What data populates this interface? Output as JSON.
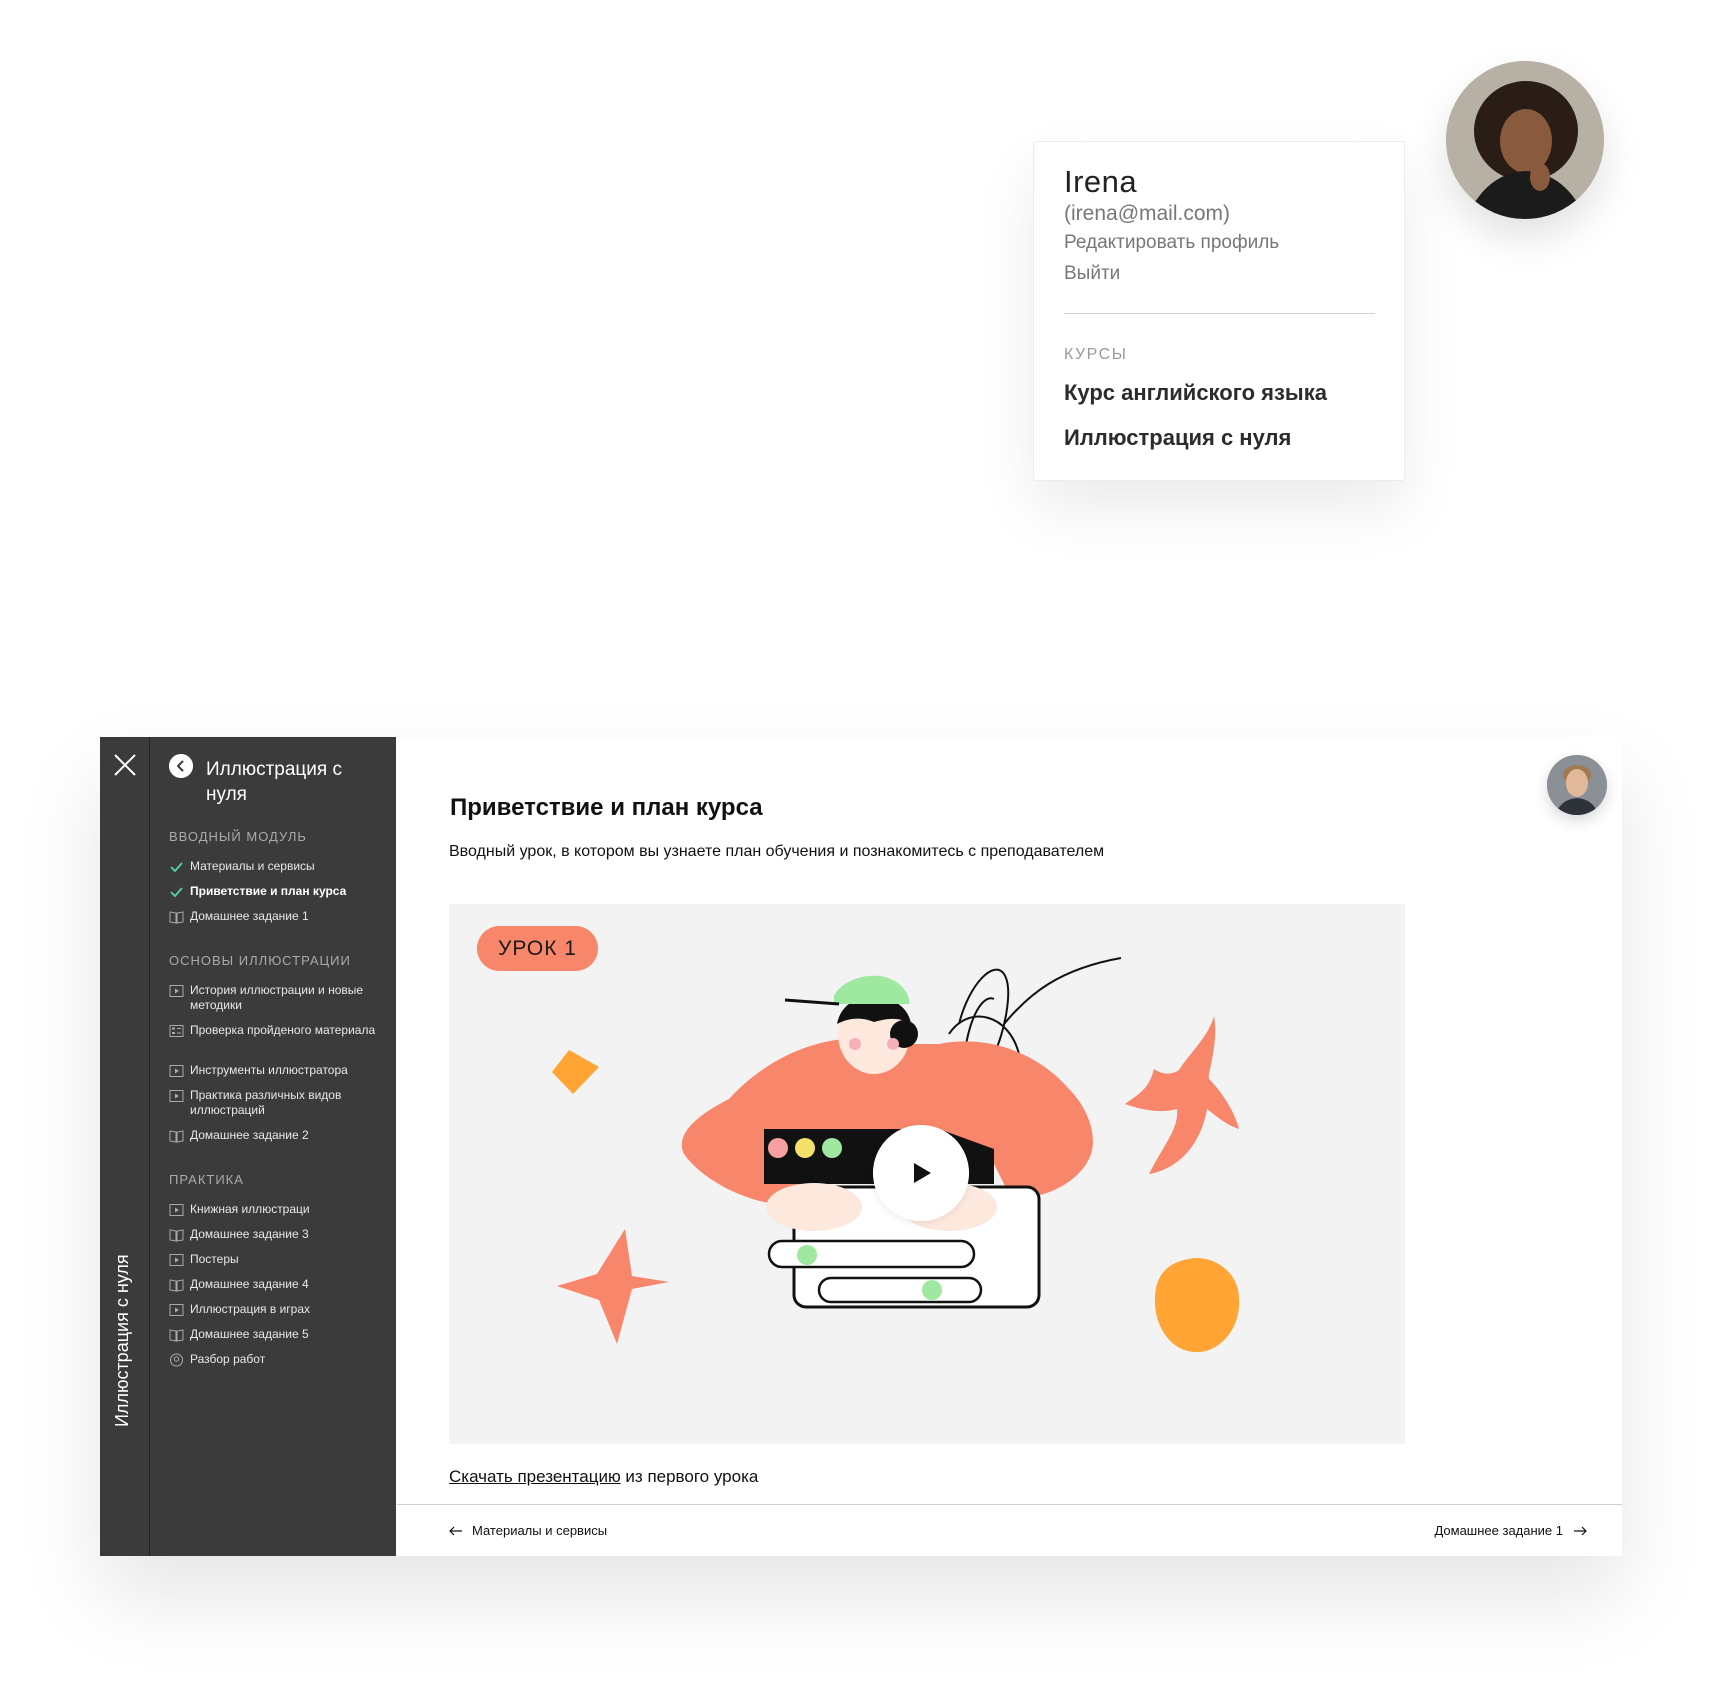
{
  "profile": {
    "name": "Irena",
    "email": "(irena@mail.com)",
    "edit_label": "Редактировать профиль",
    "logout_label": "Выйти",
    "courses_heading": "КУРСЫ",
    "courses": [
      "Курс английского языка",
      "Иллюстрация с нуля"
    ]
  },
  "course": {
    "rail_title": "Иллюстрация с нуля",
    "sidebar_title": "Иллюстрация с нуля",
    "sections": [
      {
        "title": "ВВОДНЫЙ МОДУЛЬ",
        "items": [
          {
            "label": "Материалы и сервисы",
            "icon": "check-icon"
          },
          {
            "label": "Приветствие и план курса",
            "icon": "check-icon",
            "active": true
          },
          {
            "label": "Домашнее задание 1",
            "icon": "book-icon"
          }
        ]
      },
      {
        "title": "ОСНОВЫ ИЛЛЮСТРАЦИИ",
        "items": [
          {
            "label": "История иллюстрации и новые методики",
            "icon": "video-icon"
          },
          {
            "label": "Проверка пройденого материала",
            "icon": "quiz-icon"
          },
          {
            "label": "Инструменты иллюстратора",
            "icon": "video-icon"
          },
          {
            "label": "Практика различных видов иллюстраций",
            "icon": "video-icon"
          },
          {
            "label": "Домашнее задание 2",
            "icon": "book-icon"
          }
        ]
      },
      {
        "title": "ПРАКТИКА",
        "items": [
          {
            "label": "Книжная иллюстраци",
            "icon": "video-icon"
          },
          {
            "label": "Домашнее задание 3",
            "icon": "book-icon"
          },
          {
            "label": "Постеры",
            "icon": "video-icon"
          },
          {
            "label": "Домашнее задание 4",
            "icon": "book-icon"
          },
          {
            "label": "Иллюстрация в играх",
            "icon": "video-icon"
          },
          {
            "label": "Домашнее задание 5",
            "icon": "book-icon"
          },
          {
            "label": "Разбор работ",
            "icon": "webinar-icon"
          }
        ]
      }
    ]
  },
  "lesson": {
    "title": "Приветствие и план курса",
    "description": "Вводный урок, в котором вы узнаете план обучения и познакомитесь с преподавателем",
    "badge": "УРОК 1",
    "download_link": "Скачать презентацию",
    "download_suffix": " из первого урока",
    "prev_label": "Материалы и сервисы",
    "next_label": "Домашнее задание 1"
  },
  "colors": {
    "sidebar_bg": "#3b3b3b",
    "accent_salmon": "#f8866a",
    "accent_orange": "#ffa435",
    "accent_green": "#9ee8a0",
    "check_green": "#4fd3a6"
  }
}
